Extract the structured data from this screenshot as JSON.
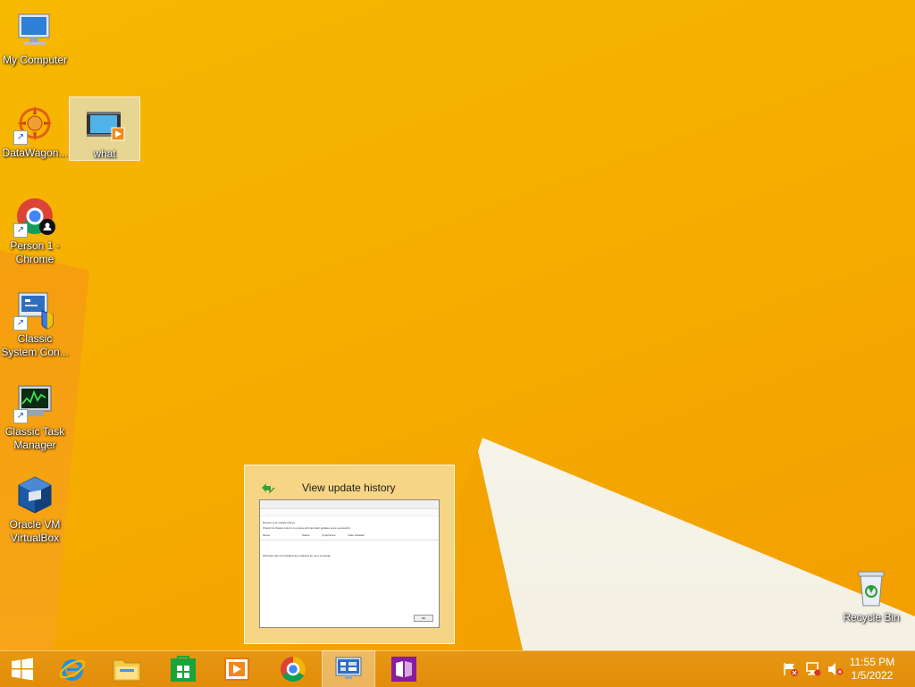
{
  "desktop": {
    "icons": [
      {
        "label": "My Computer",
        "icon": "computer-icon"
      },
      {
        "label": "DataWagon...",
        "icon": "datawagon-icon"
      },
      {
        "label": "what",
        "icon": "video-file-icon"
      },
      {
        "label": "Person 1 - Chrome",
        "icon": "chrome-icon"
      },
      {
        "label": "Classic System Con...",
        "icon": "control-panel-icon"
      },
      {
        "label": "Classic Task Manager",
        "icon": "task-manager-icon"
      },
      {
        "label": "Oracle VM VirtualBox",
        "icon": "virtualbox-icon"
      },
      {
        "label": "Recycle Bin",
        "icon": "recycle-bin-icon"
      }
    ]
  },
  "thumbnail": {
    "title": "View update history",
    "window_heading": "Review your update history",
    "window_line": "Check the Status column to ensure all important updates were successful.",
    "columns": [
      "Name",
      "Status",
      "Importance",
      "Date installed"
    ],
    "empty_text": "Windows has not installed any updates for your computer.",
    "ok_label": "OK"
  },
  "taskbar": {
    "buttons": [
      "start-button",
      "internet-explorer",
      "file-explorer",
      "store",
      "media-player",
      "chrome",
      "control-panel",
      "onenote"
    ],
    "active": "control-panel"
  },
  "tray": {
    "time": "11:55 PM",
    "date": "1/5/2022"
  },
  "colors": {
    "wallpaper": "#f5ad00",
    "taskbar": "#e3920f"
  }
}
